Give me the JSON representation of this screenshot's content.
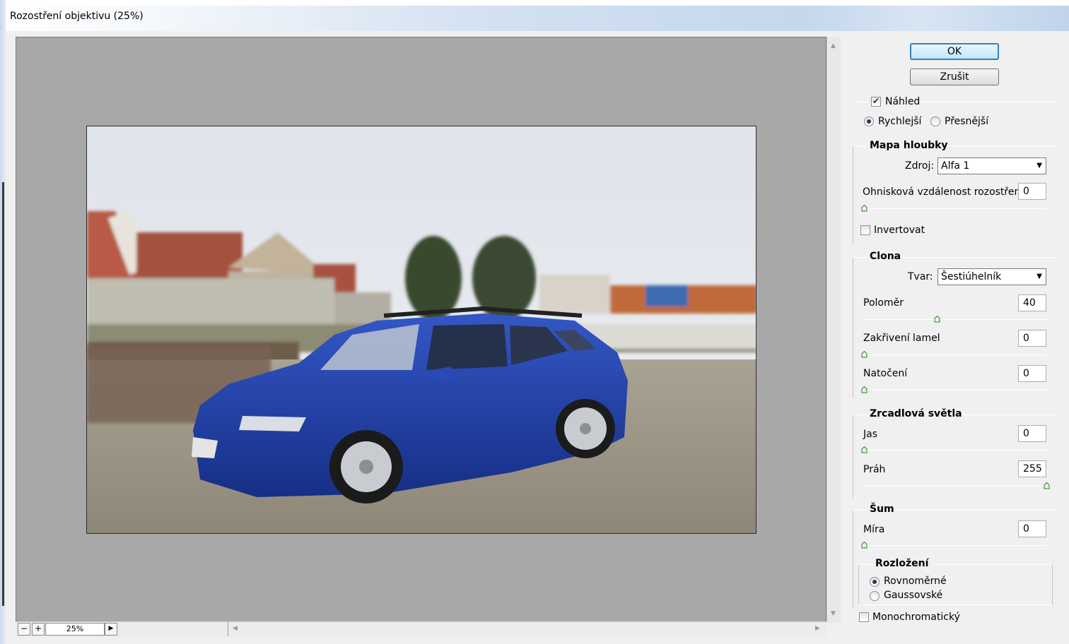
{
  "window": {
    "title": "Rozostření objektivu (25%)"
  },
  "preview": {
    "zoom_minus": "−",
    "zoom_plus": "+",
    "zoom_value": "25%",
    "zoom_menu_icon": "triangle-right-icon"
  },
  "buttons": {
    "ok": "OK",
    "cancel": "Zrušit"
  },
  "preview_options": {
    "preview_label": "Náhled",
    "preview_checked": true,
    "faster": "Rychlejší",
    "more_accurate": "Přesnější",
    "selected": "Rychlejší"
  },
  "depth_map": {
    "title": "Mapa hloubky",
    "source_label": "Zdroj:",
    "source_value": "Alfa 1",
    "focal_label": "Ohnisková vzdálenost rozostření",
    "focal_value": "0",
    "focal_fraction": 0,
    "invert_label": "Invertovat",
    "invert_checked": false
  },
  "iris": {
    "title": "Clona",
    "shape_label": "Tvar:",
    "shape_value": "Šestiúhelník",
    "radius_label": "Poloměr",
    "radius_value": "40",
    "radius_fraction": 0.4,
    "curvature_label": "Zakřivení lamel",
    "curvature_value": "0",
    "curvature_fraction": 0,
    "rotation_label": "Natočení",
    "rotation_value": "0",
    "rotation_fraction": 0
  },
  "specular": {
    "title": "Zrcadlová světla",
    "brightness_label": "Jas",
    "brightness_value": "0",
    "brightness_fraction": 0,
    "threshold_label": "Práh",
    "threshold_value": "255",
    "threshold_fraction": 1
  },
  "noise": {
    "title": "Šum",
    "amount_label": "Míra",
    "amount_value": "0",
    "amount_fraction": 0,
    "distribution_title": "Rozložení",
    "uniform": "Rovnoměrné",
    "gaussian": "Gaussovské",
    "selected": "Rovnoměrné",
    "mono_label": "Monochromatický",
    "mono_checked": false
  },
  "colors": {
    "accent": "#3c7fb1",
    "car": "#1f3c9e",
    "preview_bg": "#a8a8a8"
  }
}
